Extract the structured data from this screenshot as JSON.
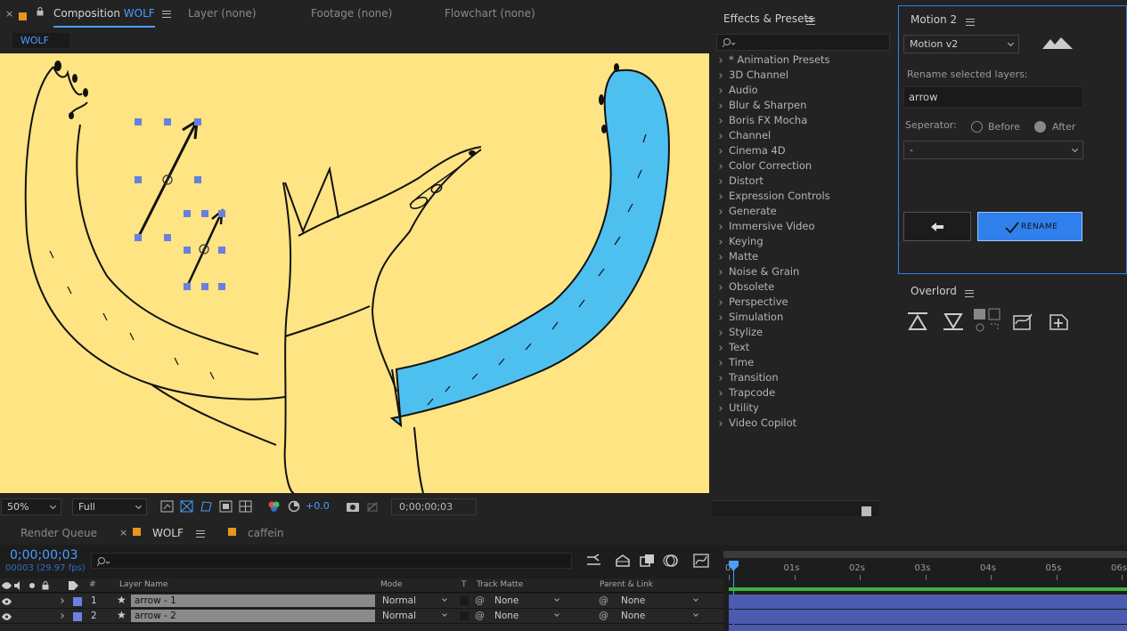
{
  "comp_tabs": {
    "composition_label": "Composition",
    "composition_name": "WOLF",
    "layer_label": "Layer (none)",
    "footage_label": "Footage (none)",
    "flowchart_label": "Flowchart (none)",
    "breadcrumb": "WOLF"
  },
  "viewer_toolbar": {
    "zoom": "50%",
    "resolution": "Full",
    "exposure": "+0.0",
    "timecode": "0;00;00;03"
  },
  "effects": {
    "panel_title": "Effects & Presets",
    "search_placeholder": "",
    "items": [
      "* Animation Presets",
      "3D Channel",
      "Audio",
      "Blur & Sharpen",
      "Boris FX Mocha",
      "Channel",
      "Cinema 4D",
      "Color Correction",
      "Distort",
      "Expression Controls",
      "Generate",
      "Immersive Video",
      "Keying",
      "Matte",
      "Noise & Grain",
      "Obsolete",
      "Perspective",
      "Simulation",
      "Stylize",
      "Text",
      "Time",
      "Transition",
      "Trapcode",
      "Utility",
      "Video Copilot"
    ]
  },
  "motion": {
    "panel_title": "Motion 2",
    "tool_select": "Motion v2",
    "rename_label": "Rename selected layers:",
    "rename_value": "arrow",
    "separator_label": "Seperator:",
    "before_label": "Before",
    "after_label": "After",
    "separator_value": "-",
    "rename_button": "RENAME",
    "accent": "#2f80ed"
  },
  "overlord": {
    "panel_title": "Overlord"
  },
  "timeline": {
    "tabs": {
      "render_queue": "Render Queue",
      "wolf": "WOLF",
      "caffein": "caffein"
    },
    "timecode": "0;00;00;03",
    "frame_info": "00003 (29.97 fps)",
    "columns": {
      "hash": "#",
      "layer_name": "Layer Name",
      "mode": "Mode",
      "t": "T",
      "track_matte": "Track Matte",
      "parent": "Parent & Link"
    },
    "ruler": [
      "0s",
      "01s",
      "02s",
      "03s",
      "04s",
      "05s",
      "06s"
    ],
    "layers": [
      {
        "num": "1",
        "name": "arrow - 1",
        "mode": "Normal",
        "matte": "None",
        "parent": "None",
        "color": "#6e7fe3"
      },
      {
        "num": "2",
        "name": "arrow - 2",
        "mode": "Normal",
        "matte": "None",
        "parent": "None",
        "color": "#6e7fe3"
      }
    ]
  },
  "colors": {
    "canvas_bg": "#ffe483",
    "arm_blue": "#4ec0f0",
    "tab_orange": "#e8951c",
    "selection_blue": "#4a9eff"
  }
}
